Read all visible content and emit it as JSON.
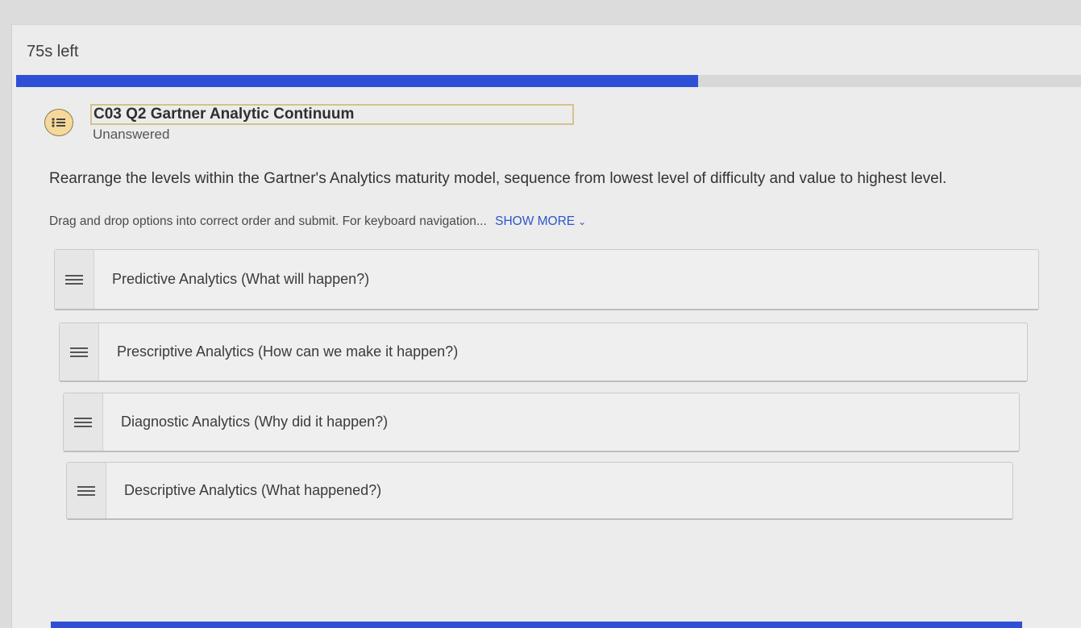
{
  "timer": {
    "text": "75s left"
  },
  "progress": {
    "fraction": 0.64,
    "color": "#2f4fd6"
  },
  "question": {
    "icon": "list-bubble-icon",
    "title": "C03 Q2 Gartner Analytic Continuum",
    "status": "Unanswered",
    "prompt": "Rearrange the levels within the Gartner's Analytics maturity model, sequence from lowest  level of difficulty and value to highest level.",
    "instructions": "Drag and drop options into correct order and submit. For keyboard navigation...",
    "show_more_label": "SHOW MORE"
  },
  "options": [
    {
      "label": "Predictive Analytics (What will happen?)"
    },
    {
      "label": "Prescriptive Analytics (How can we make it happen?)"
    },
    {
      "label": "Diagnostic Analytics (Why did it happen?)"
    },
    {
      "label": "Descriptive Analytics (What happened?)"
    }
  ],
  "colors": {
    "accent": "#2f4fd6",
    "link": "#2f55c8",
    "icon_bg": "#f6d89a"
  }
}
